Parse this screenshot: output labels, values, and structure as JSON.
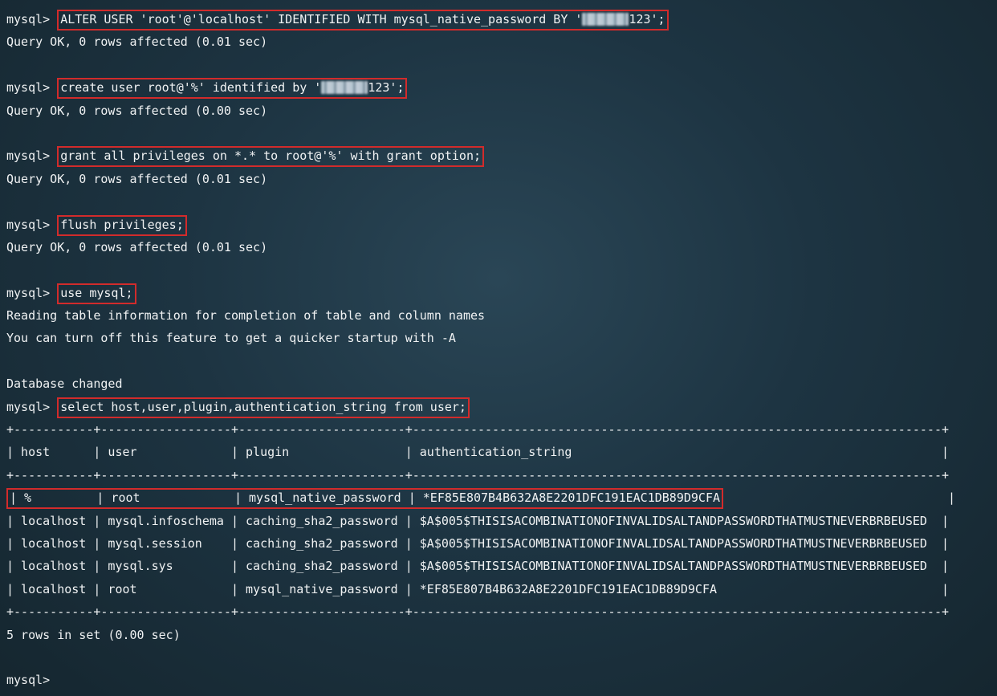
{
  "prompt": "mysql>",
  "blocks": [
    {
      "cmd_parts": [
        "ALTER USER 'root'@'localhost' IDENTIFIED WITH mysql_native_password BY '",
        "REDACTED",
        "123';"
      ],
      "response": [
        "Query OK, 0 rows affected (0.01 sec)"
      ],
      "blank_after": true
    },
    {
      "cmd_parts": [
        "create user root@'%' identified by '",
        "REDACTED",
        "123';"
      ],
      "response": [
        "Query OK, 0 rows affected (0.00 sec)"
      ],
      "blank_after": true
    },
    {
      "cmd_parts": [
        "grant all privileges on *.* to root@'%' with grant option;"
      ],
      "response": [
        "Query OK, 0 rows affected (0.01 sec)"
      ],
      "blank_after": true
    },
    {
      "cmd_parts": [
        "flush privileges;"
      ],
      "response": [
        "Query OK, 0 rows affected (0.01 sec)"
      ],
      "blank_after": true
    },
    {
      "cmd_parts": [
        "use mysql;"
      ],
      "response": [
        "Reading table information for completion of table and column names",
        "You can turn off this feature to get a quicker startup with -A",
        "",
        "Database changed"
      ],
      "blank_after": false
    },
    {
      "cmd_parts": [
        "select host,user,plugin,authentication_string from user;"
      ],
      "response": [],
      "blank_after": false
    }
  ],
  "table": {
    "border_top": "+-----------+------------------+-----------------------+-------------------------------------------------------------------------+",
    "header": "| host      | user             | plugin                | authentication_string                                                   |",
    "border_mid": "+-----------+------------------+-----------------------+-------------------------------------------------------------------------+",
    "rows": [
      "| %         | root             | mysql_native_password | *EF85E807B4B632A8E2201DFC191EAC1DB89D9CFA                               |",
      "| localhost | mysql.infoschema | caching_sha2_password | $A$005$THISISACOMBINATIONOFINVALIDSALTANDPASSWORDTHATMUSTNEVERBRBEUSED  |",
      "| localhost | mysql.session    | caching_sha2_password | $A$005$THISISACOMBINATIONOFINVALIDSALTANDPASSWORDTHATMUSTNEVERBRBEUSED  |",
      "| localhost | mysql.sys        | caching_sha2_password | $A$005$THISISACOMBINATIONOFINVALIDSALTANDPASSWORDTHATMUSTNEVERBRBEUSED  |",
      "| localhost | root             | mysql_native_password | *EF85E807B4B632A8E2201DFC191EAC1DB89D9CFA                               |"
    ],
    "highlighted_row_index": 0,
    "border_bot": "+-----------+------------------+-----------------------+-------------------------------------------------------------------------+",
    "footer": "5 rows in set (0.00 sec)"
  },
  "final_prompt": "mysql>"
}
